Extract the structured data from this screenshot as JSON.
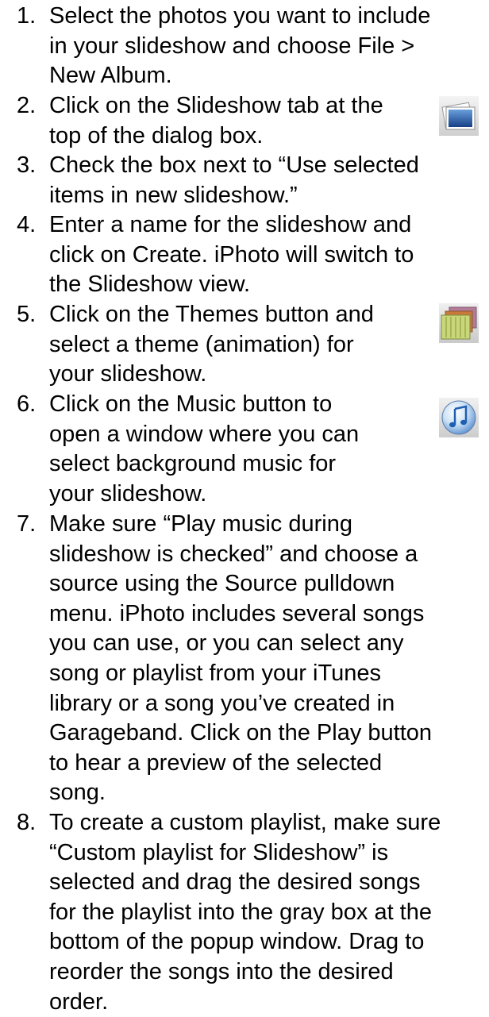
{
  "steps": [
    {
      "number": "1.",
      "text": "Select the photos you want to include\nin your slideshow and choose File >\nNew Album."
    },
    {
      "number": "2.",
      "text": "Click on the Slideshow tab at the\ntop of the dialog box.",
      "icon": "slideshow-tab-icon"
    },
    {
      "number": "3.",
      "text": "Check the box next to “Use selected\nitems in new slideshow.”"
    },
    {
      "number": "4.",
      "text": "Enter a name for the slideshow and\nclick on Create. iPhoto will switch to\nthe Slideshow view."
    },
    {
      "number": "5.",
      "text": "Click on the Themes button and\nselect a theme (animation) for\nyour slideshow.",
      "icon": "themes-icon"
    },
    {
      "number": "6.",
      "text": "Click on the Music button to\nopen a window where you can\nselect background music for\nyour slideshow.",
      "icon": "music-icon"
    },
    {
      "number": "7.",
      "text": "Make sure “Play music during\nslideshow is checked” and choose a\nsource using the Source pulldown\nmenu. iPhoto includes several songs\nyou can use, or you can select any\nsong or playlist from your iTunes\nlibrary or a song you’ve created in\nGarageband. Click on the Play button\nto hear a preview of the selected\nsong."
    },
    {
      "number": "8.",
      "text": "To create a custom playlist, make sure\n“Custom playlist for Slideshow” is\nselected and drag the desired songs\nfor the playlist into the gray box at the\nbottom of the popup window. Drag to\nreorder the songs into the desired\norder."
    }
  ]
}
